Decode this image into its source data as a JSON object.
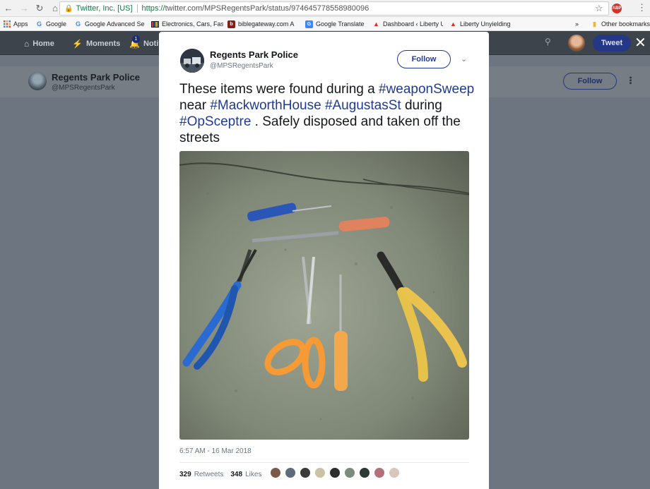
{
  "browser": {
    "security_label": "Twitter, Inc. [US]",
    "url_scheme": "https://",
    "url_rest": "twitter.com/MPSRegentsPark/status/974645778558980096",
    "bookmarks": [
      {
        "label": "Apps",
        "icon": "apps-grid-icon"
      },
      {
        "label": "Google",
        "icon": "google-icon"
      },
      {
        "label": "Google Advanced Se",
        "icon": "google-icon"
      },
      {
        "label": "Electronics, Cars, Fas",
        "icon": "ebay-icon"
      },
      {
        "label": "biblegateway.com A",
        "icon": "biblegateway-icon"
      },
      {
        "label": "Google Translate",
        "icon": "translate-icon"
      },
      {
        "label": "Dashboard ‹ Liberty U",
        "icon": "flame-icon"
      },
      {
        "label": "Liberty Unyielding",
        "icon": "flame-icon"
      }
    ],
    "overflow": "»",
    "other_bookmarks": "Other bookmarks",
    "abp_label": "ABP"
  },
  "twitter_nav": {
    "home": "Home",
    "moments": "Moments",
    "notifications": "Notif",
    "notification_count": "1",
    "tweet_button": "Tweet"
  },
  "profile_header": {
    "name": "Regents Park Police",
    "handle": "@MPSRegentsPark",
    "follow": "Follow"
  },
  "tweet": {
    "name": "Regents Park Police",
    "handle": "@MPSRegentsPark",
    "follow": "Follow",
    "text_parts": [
      {
        "text": "These items were found during a ",
        "hashtag": false
      },
      {
        "text": "#weaponSweep",
        "hashtag": true
      },
      {
        "text": " near ",
        "hashtag": false
      },
      {
        "text": "#MackworthHouse",
        "hashtag": true
      },
      {
        "text": " ",
        "hashtag": false
      },
      {
        "text": "#AugustasSt",
        "hashtag": true
      },
      {
        "text": " during ",
        "hashtag": false
      },
      {
        "text": "#OpSceptre",
        "hashtag": true
      },
      {
        "text": " . Safely disposed and taken off the streets",
        "hashtag": false
      }
    ],
    "timestamp": "6:57 AM - 16 Mar 2018",
    "retweets_count": "329",
    "retweets_label": "Retweets",
    "likes_count": "348",
    "likes_label": "Likes",
    "liker_colors": [
      "#7a5b4a",
      "#5e6b7a",
      "#3a3a3a",
      "#c9c2a5",
      "#2d2d2d",
      "#7c8a80",
      "#2b3a33",
      "#b4707a",
      "#d8c7bb"
    ]
  },
  "colors": {
    "accent": "#1f3a93",
    "tweet_button": "#253886"
  }
}
